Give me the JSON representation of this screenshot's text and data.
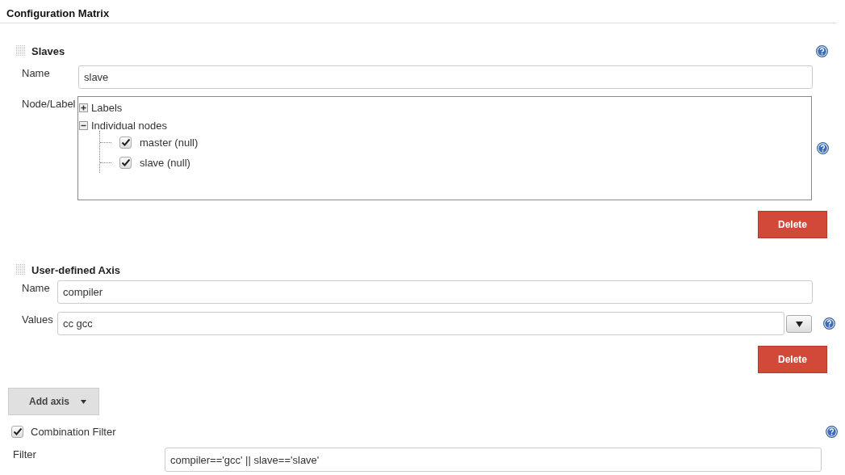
{
  "title": "Configuration Matrix",
  "axes": [
    {
      "kind": "slaves",
      "heading": "Slaves",
      "name_label": "Name",
      "name_value": "slave",
      "node_label": "Node/Label",
      "tree": [
        {
          "label": "Labels",
          "expanded": false
        },
        {
          "label": "Individual nodes",
          "expanded": true,
          "children": [
            {
              "label": "master (null)",
              "checked": true
            },
            {
              "label": "slave (null)",
              "checked": true
            }
          ]
        }
      ],
      "delete": "Delete"
    },
    {
      "kind": "user_defined",
      "heading": "User-defined Axis",
      "name_label": "Name",
      "name_value": "compiler",
      "values_label": "Values",
      "values_value": "cc gcc",
      "delete": "Delete"
    }
  ],
  "add_axis": "Add axis",
  "combination_filter": {
    "label": "Combination Filter",
    "checked": true,
    "filter_label": "Filter",
    "filter_value": "compiler=='gcc' || slave=='slave'"
  }
}
